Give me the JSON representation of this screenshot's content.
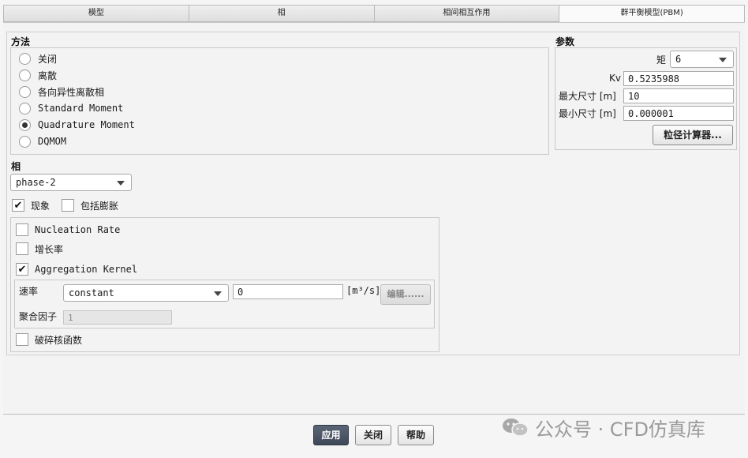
{
  "tabs": [
    {
      "label": "模型"
    },
    {
      "label": "相"
    },
    {
      "label": "相间相互作用"
    },
    {
      "label": "群平衡模型(PBM)",
      "active": true
    }
  ],
  "method": {
    "title": "方法",
    "options": [
      "关闭",
      "离散",
      "各向异性离散相",
      "Standard Moment",
      "Quadrature Moment",
      "DQMOM"
    ],
    "selected": "Quadrature Moment"
  },
  "params": {
    "title": "参数",
    "moment_label": "矩",
    "moment_value": "6",
    "kv_label": "Kv",
    "kv_value": "0.5235988",
    "max_size_label": "最大尺寸 [m]",
    "max_size_value": "10",
    "min_size_label": "最小尺寸 [m]",
    "min_size_value": "0.000001",
    "calc_button": "粒径计算器..."
  },
  "phase": {
    "title": "相",
    "value": "phase-2",
    "phenomena_label": "现象",
    "phenomena_checked": true,
    "include_expansion_label": "包括膨胀",
    "include_expansion_checked": false
  },
  "phenomena": {
    "nucleation_label": "Nucleation Rate",
    "nucleation_checked": false,
    "growth_label": "增长率",
    "growth_checked": false,
    "aggregation_label": "Aggregation Kernel",
    "aggregation_checked": true,
    "rate_label": "速率",
    "rate_method": "constant",
    "rate_value": "0",
    "rate_unit": "[m³/s]",
    "edit_button": "编辑......",
    "factor_label": "聚合因子",
    "factor_value": "1",
    "breakage_label": "破碎核函数",
    "breakage_checked": false
  },
  "footer": {
    "apply": "应用",
    "close": "关闭",
    "help": "帮助"
  },
  "watermark": "公众号 · CFD仿真库"
}
